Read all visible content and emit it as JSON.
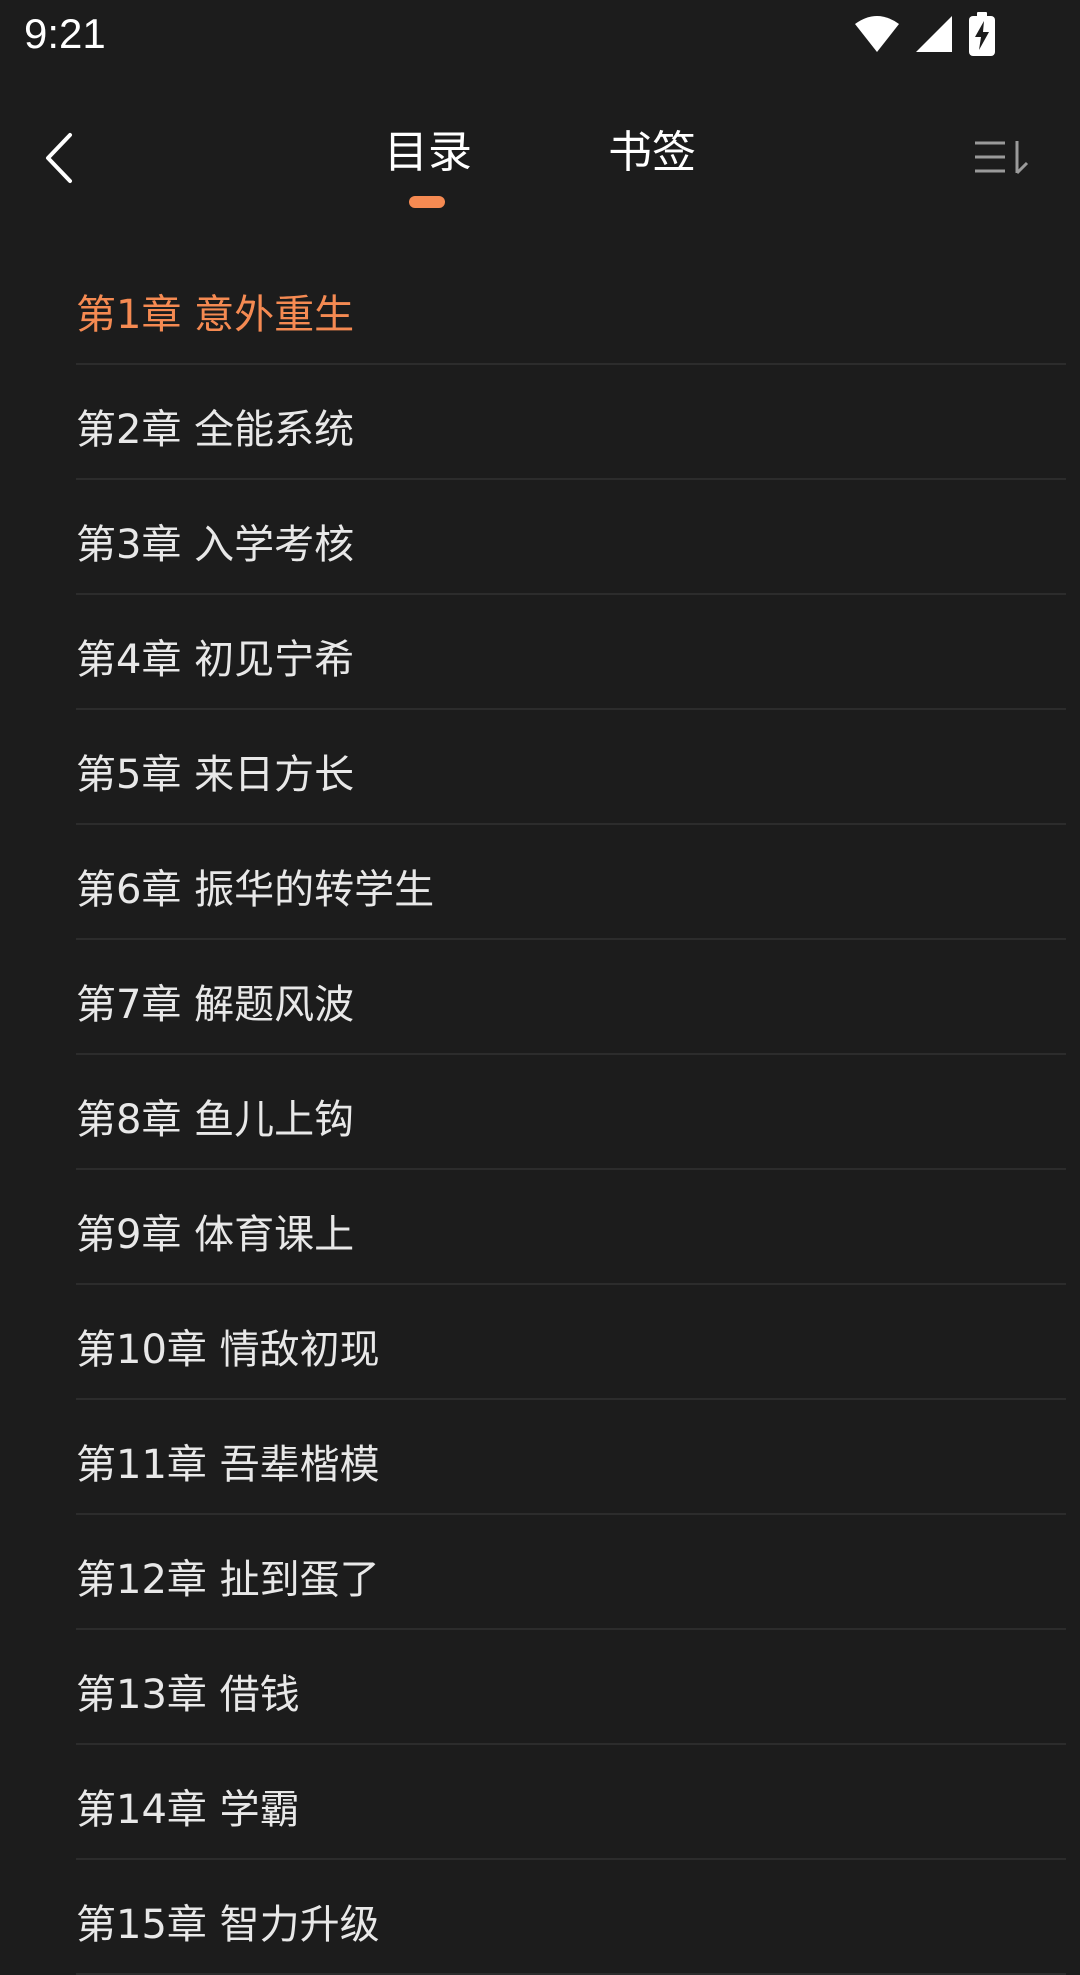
{
  "status_bar": {
    "time": "9:21",
    "icons": [
      "wifi-icon",
      "cell-signal-icon",
      "battery-charging-icon"
    ]
  },
  "top_bar": {
    "back_icon": "chevron-left-icon",
    "tabs": [
      {
        "label": "目录",
        "selected": true
      },
      {
        "label": "书签",
        "selected": false
      }
    ],
    "sort_icon": "sort-descending-icon"
  },
  "colors": {
    "accent": "#f58a52",
    "background": "#1c1c1c",
    "text": "#e8e8e8",
    "divider": "#2c2c2c"
  },
  "chapters": [
    {
      "label": "第1章 意外重生",
      "current": true
    },
    {
      "label": "第2章 全能系统"
    },
    {
      "label": "第3章 入学考核"
    },
    {
      "label": "第4章 初见宁希"
    },
    {
      "label": "第5章 来日方长"
    },
    {
      "label": "第6章 振华的转学生"
    },
    {
      "label": "第7章 解题风波"
    },
    {
      "label": "第8章 鱼儿上钩"
    },
    {
      "label": "第9章 体育课上"
    },
    {
      "label": "第10章 情敌初现"
    },
    {
      "label": "第11章 吾辈楷模"
    },
    {
      "label": "第12章 扯到蛋了"
    },
    {
      "label": "第13章 借钱"
    },
    {
      "label": "第14章 学霸"
    },
    {
      "label": "第15章 智力升级"
    }
  ]
}
